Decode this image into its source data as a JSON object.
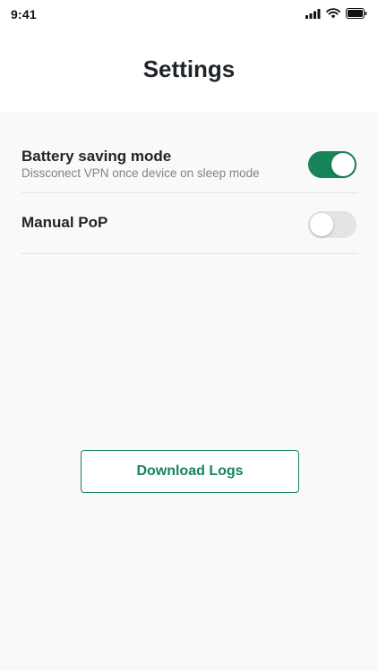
{
  "status_bar": {
    "time": "9:41",
    "icons": [
      "cellular-signal-icon",
      "wifi-icon",
      "battery-icon"
    ]
  },
  "header": {
    "title": "Settings"
  },
  "settings": {
    "battery_saving": {
      "title": "Battery saving mode",
      "subtitle": "Dissconect VPN once device on sleep mode",
      "enabled": true
    },
    "manual_pop": {
      "title": "Manual PoP",
      "enabled": false
    }
  },
  "actions": {
    "download_logs_label": "Download Logs"
  },
  "colors": {
    "accent": "#18845a",
    "toggle_off": "#e4e4e4",
    "content_background": "#f9f9f9",
    "text_primary": "#1f2428",
    "text_secondary": "#808386"
  }
}
